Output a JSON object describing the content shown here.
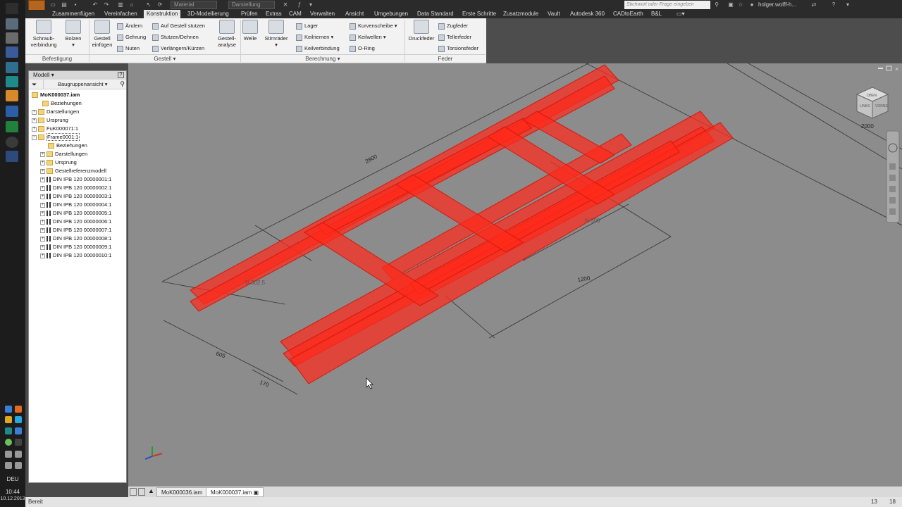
{
  "taskbar": {
    "language": "DEU",
    "time": "10:44",
    "date": "10.12.2013"
  },
  "quick_access": {
    "material_placeholder": "Material",
    "appearance_placeholder": "Darstellung",
    "search_placeholder": "Stichwort oder Frage eingeben",
    "user": "holger.wolff-h..."
  },
  "menu": [
    "Zusammenfügen",
    "Vereinfachen",
    "Konstruktion",
    "3D-Modellierung",
    "Prüfen",
    "Extras",
    "CAM",
    "Verwalten",
    "Ansicht",
    "Umgebungen",
    "Data Standard",
    "Erste Schritte",
    "Zusatzmodule",
    "Vault",
    "Autodesk 360",
    "CADtoEarth",
    "B&L"
  ],
  "menu_active": "Konstruktion",
  "ribbon": {
    "befestigung": {
      "label": "Befestigung",
      "schraub": "Schraub-",
      "schraub2": "verbindung",
      "bolzen": "Bolzen"
    },
    "gestell": {
      "label": "Gestell",
      "einfuegen": "Gestell",
      "einfuegen2": "einfügen",
      "aendern": "Ändern",
      "gehrung": "Gehrung",
      "nuten": "Nuten",
      "stutzen": "Auf Gestell stutzen",
      "dehnen": "Stutzen/Dehnen",
      "verlaengern": "Verlängern/Kürzen",
      "analyse": "Gestell-",
      "analyse2": "analyse"
    },
    "berechnung": {
      "label": "Berechnung",
      "welle": "Welle",
      "stirnraeder": "Stirnräder",
      "lager": "Lager",
      "keilriemen": "Keilriemen",
      "keilverbindung": "Keilverbindung",
      "kurvenscheibe": "Kurvenscheibe",
      "keilwellen": "Keilwellen",
      "oring": "O-Ring"
    },
    "feder": {
      "label": "Feder",
      "druckfeder": "Druckfeder",
      "zugfeder": "Zugfeder",
      "tellerfeder": "Tellerfeder",
      "torsionsfeder": "Torsionsfeder"
    }
  },
  "browser": {
    "title": "Modell",
    "view": "Baugruppenansicht",
    "root": "MoK000037.iam",
    "items": [
      {
        "label": "Beziehungen"
      },
      {
        "label": "Darstellungen"
      },
      {
        "label": "Ursprung"
      },
      {
        "label": "FuK000071:1"
      },
      {
        "label": "Frame0001:1"
      },
      {
        "label": "Beziehungen"
      },
      {
        "label": "Darstellungen"
      },
      {
        "label": "Ursprung"
      },
      {
        "label": "Gestellreferenzmodell"
      },
      {
        "label": "DIN IPB 120 00000001:1"
      },
      {
        "label": "DIN IPB 120 00000002:1"
      },
      {
        "label": "DIN IPB 120 00000003:1"
      },
      {
        "label": "DIN IPB 120 00000004:1"
      },
      {
        "label": "DIN IPB 120 00000005:1"
      },
      {
        "label": "DIN IPB 120 00000006:1"
      },
      {
        "label": "DIN IPB 120 00000007:1"
      },
      {
        "label": "DIN IPB 120 00000008:1"
      },
      {
        "label": "DIN IPB 120 00000009:1"
      },
      {
        "label": "DIN IPB 120 00000010:1"
      }
    ]
  },
  "dimensions": {
    "d2800": "2800",
    "d2000": "2000",
    "d1200": "1200",
    "d605": "605",
    "d170": "170",
    "d302": "N 302,5",
    "d500": "N 500"
  },
  "viewcube": {
    "front": "VORNE",
    "left": "LINKS",
    "top": "OBEN"
  },
  "documents": {
    "tab1": "MoK000036.iam",
    "tab2": "MoK000037.iam"
  },
  "status": {
    "text": "Bereit",
    "n1": "13",
    "n2": "18"
  },
  "colors": {
    "frame": "#ff2a1a",
    "viewport": "#8c8c8c",
    "ribbon": "#f2f2f2"
  }
}
